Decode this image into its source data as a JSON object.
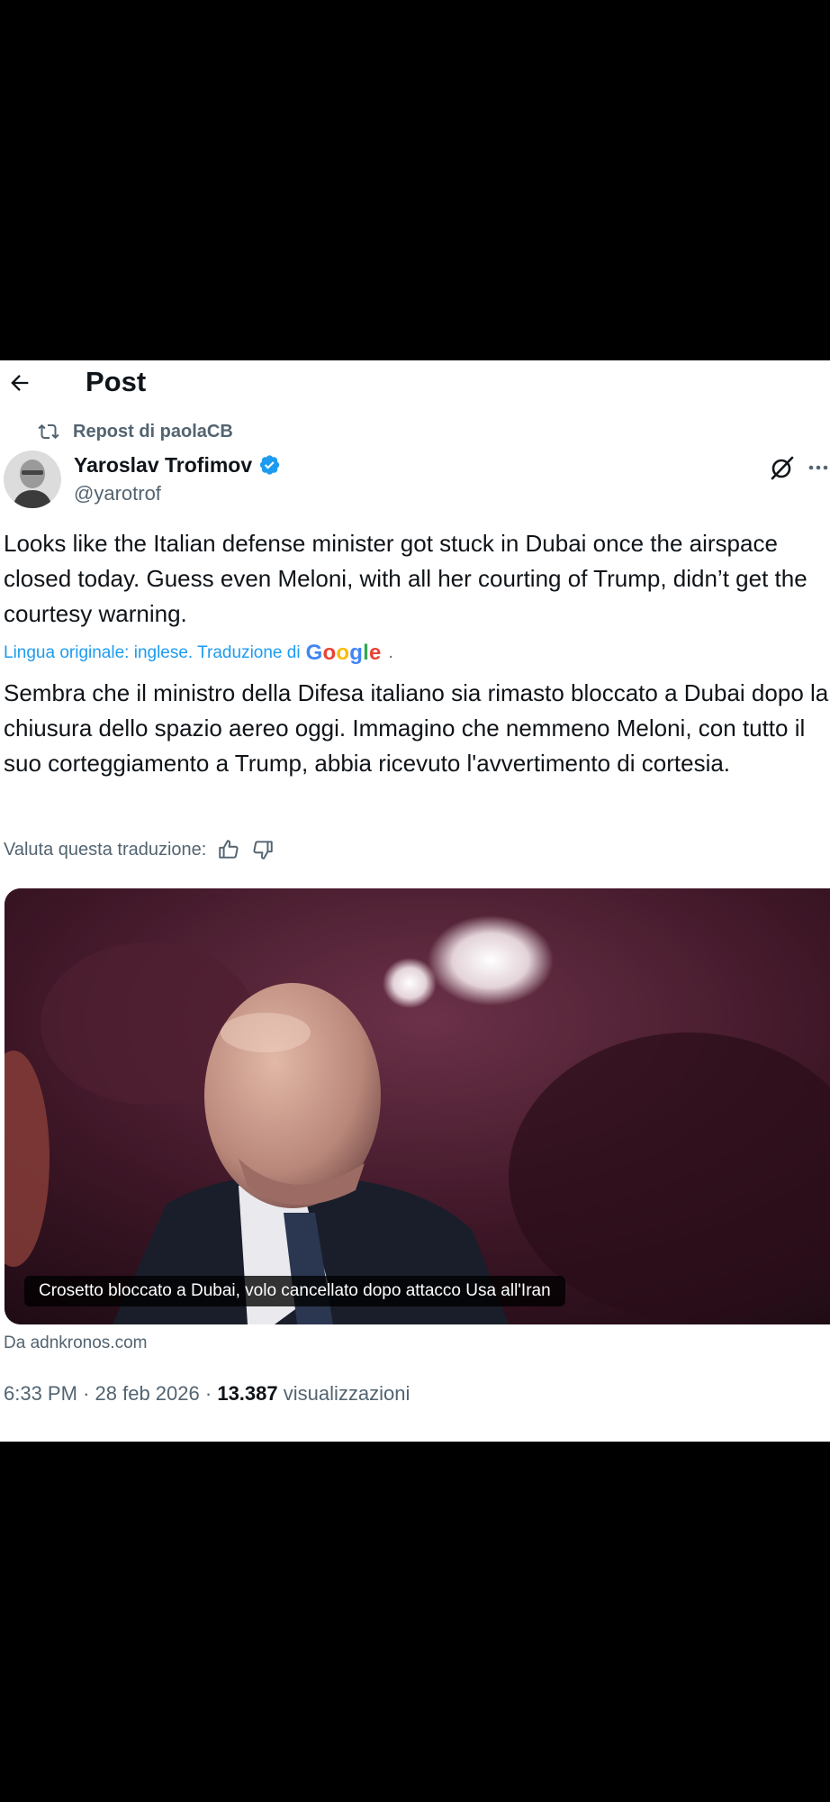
{
  "header": {
    "title": "Post"
  },
  "repost": {
    "label": "Repost di paolaCB"
  },
  "author": {
    "name": "Yaroslav Trofimov",
    "handle": "@yarotrof"
  },
  "tweet": {
    "text": "Looks like the Italian defense minister got stuck in Dubai once the airspace closed today. Guess even Meloni, with all her courting of Trump, didn’t get the courtesy warning."
  },
  "translation": {
    "notice": "Lingua originale: inglese. Traduzione di",
    "provider": "Google",
    "trailing": ".",
    "text": "Sembra che il ministro della Difesa italiano sia rimasto bloccato a Dubai dopo la chiusura dello spazio aereo oggi. Immagino che nemmeno Meloni, con tutto il suo corteggiamento a Trump, abbia ricevuto l'avvertimento di cortesia.",
    "rate_label": "Valuta questa traduzione:"
  },
  "media": {
    "caption": "Crosetto bloccato a Dubai, volo cancellato dopo attacco Usa all'Iran",
    "source": "Da adnkronos.com"
  },
  "meta": {
    "time": "6:33 PM",
    "sep1": "·",
    "date": "28 feb 2026",
    "sep2": "·",
    "views": "13.387",
    "views_label": "visualizzazioni"
  },
  "colors": {
    "text": "#0f1419",
    "secondary": "#536471",
    "accent": "#1d9bf0",
    "verified": "#1d9bf0",
    "background": "#ffffff",
    "letterbox": "#000000"
  },
  "icons": [
    "back-arrow-icon",
    "repost-icon",
    "verified-badge-icon",
    "grok-icon",
    "more-icon",
    "thumbs-up-icon",
    "thumbs-down-icon"
  ]
}
